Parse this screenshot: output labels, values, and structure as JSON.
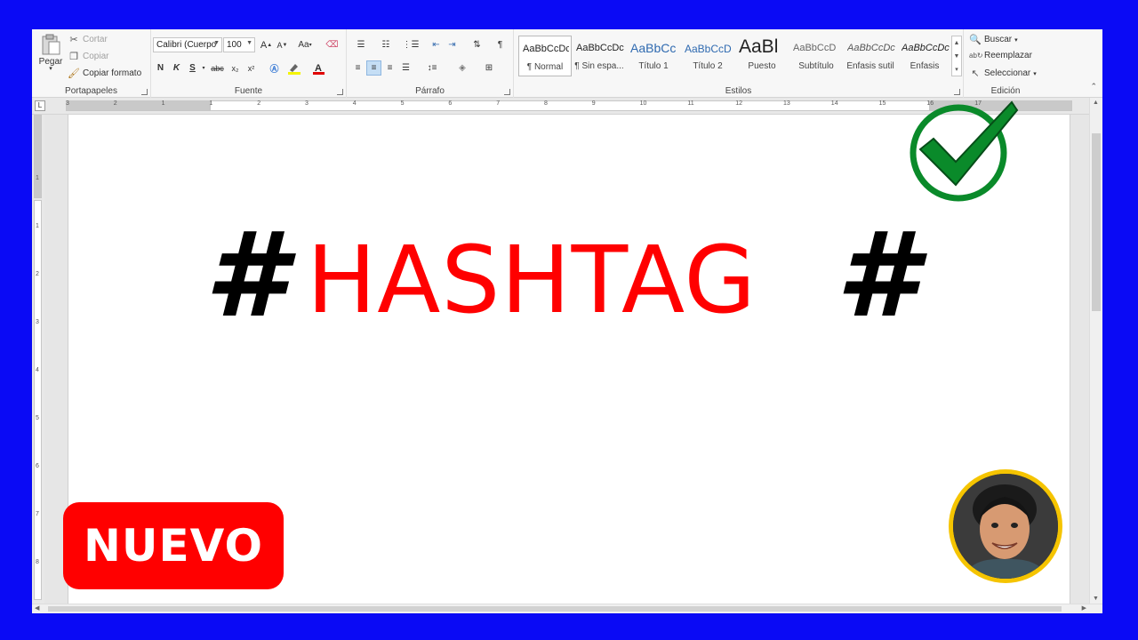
{
  "ribbon": {
    "portapapeles": {
      "label": "Portapapeles",
      "paste": "Pegar",
      "cut": "Cortar",
      "copy": "Copiar",
      "format_painter": "Copiar formato"
    },
    "fuente": {
      "label": "Fuente",
      "font_name": "Calibri (Cuerpo",
      "font_size": "100",
      "bold": "N",
      "italic": "K",
      "underline": "S",
      "strike": "abc",
      "subscript": "x₂",
      "superscript": "x²",
      "change_case": "Aa",
      "grow": "A",
      "shrink": "A"
    },
    "parrafo": {
      "label": "Párrafo"
    },
    "estilos": {
      "label": "Estilos",
      "items": [
        {
          "sample": "AaBbCcDc",
          "name": "¶ Normal"
        },
        {
          "sample": "AaBbCcDc",
          "name": "¶ Sin espa..."
        },
        {
          "sample": "AaBbCc",
          "name": "Título 1"
        },
        {
          "sample": "AaBbCcD",
          "name": "Título 2"
        },
        {
          "sample": "AaBl",
          "name": "Puesto"
        },
        {
          "sample": "AaBbCcD",
          "name": "Subtítulo"
        },
        {
          "sample": "AaBbCcDc",
          "name": "Énfasis sutil"
        },
        {
          "sample": "AaBbCcDc",
          "name": "Énfasis"
        }
      ]
    },
    "edicion": {
      "label": "Edición",
      "find": "Buscar",
      "replace": "Reemplazar",
      "select": "Seleccionar"
    }
  },
  "ruler": {
    "h_ticks": [
      "3",
      "2",
      "1",
      "1",
      "2",
      "3",
      "4",
      "5",
      "6",
      "7",
      "8",
      "9",
      "10",
      "11",
      "12",
      "13",
      "14",
      "15",
      "16",
      "17"
    ],
    "v_ticks": [
      "1",
      "1",
      "2",
      "3",
      "4",
      "5",
      "6",
      "7",
      "8"
    ],
    "tab_selector": "L"
  },
  "document": {
    "hash_left": "#",
    "headline": "HASHTAG",
    "hash_right": "#"
  },
  "overlay": {
    "badge": "NUEVO"
  },
  "colors": {
    "frame": "#0a0af5",
    "headline": "#ff0000",
    "badge_bg": "#ff0000",
    "check": "#0a8a2a",
    "avatar_ring": "#f5c400"
  }
}
